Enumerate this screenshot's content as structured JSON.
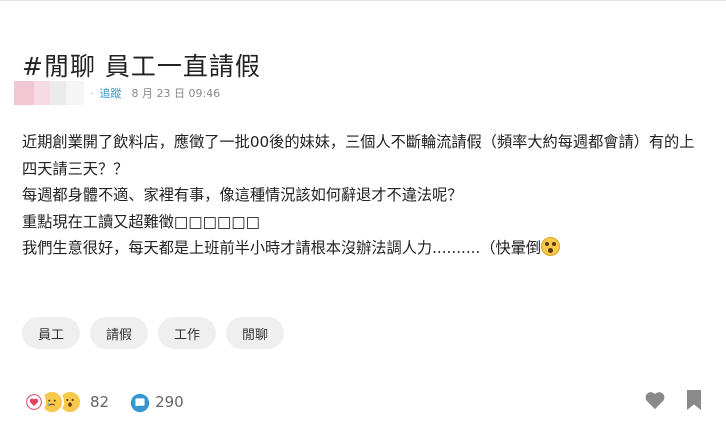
{
  "post": {
    "title": "#閒聊 員工一直請假",
    "meta": {
      "separator": "·",
      "follow_label": "追蹤",
      "timestamp": "8 月 23 日 09:46"
    },
    "body": [
      "近期創業開了飲料店，應徵了一批00後的妹妹，三個人不斷輪流請假（頻率大約每週都會請）有的上四天請三天？？",
      "每週都身體不適、家裡有事，像這種情況該如何辭退才不違法呢？",
      "重點現在工讀又超難徵□□□□□□",
      "我們生意很好，每天都是上班前半小時才請根本沒辦法調人力..........（快暈倒"
    ],
    "tags": [
      "員工",
      "請假",
      "工作",
      "閒聊"
    ],
    "reaction_icons": [
      "heart-icon",
      "crying-face-icon",
      "surprised-face-icon"
    ],
    "reaction_count": "82",
    "comment_count": "290"
  },
  "colors": {
    "accent_link": "#3397cf",
    "comment_icon": "#3397cf",
    "heart_red": "#e4405f",
    "emoji_yellow": "#f7c84a",
    "muted_icon": "#8a8a8a"
  }
}
